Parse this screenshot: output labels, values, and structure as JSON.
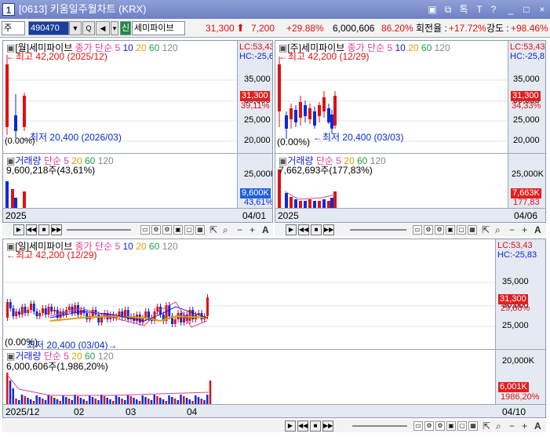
{
  "window": {
    "number": "1",
    "title": "[0613] 키움일주월차트 (KRX)",
    "controls": [
      "▣",
      "⧉",
      "톡",
      "T",
      "?",
      "_",
      "□",
      "×"
    ]
  },
  "toolbar": {
    "market": "주",
    "code": "490470",
    "badge": "신",
    "name": "세미파이브",
    "price": "31,300",
    "change": "7,200",
    "change_pct": "+29.88%",
    "volume": "6,000,606",
    "vol_ratio": "86.20%",
    "turnover_label": "회전율 :",
    "turnover": "+17.72%",
    "strength_label": "강도 :",
    "strength": "+98.46%"
  },
  "monthly": {
    "legend_name": "[월]세미파이브",
    "legend_ma": "종가 단순",
    "ma_periods": [
      "5",
      "10",
      "20",
      "60",
      "120"
    ],
    "high_text": "최고 42,200 (2025/12)",
    "low_text": "최저 20,400 (2026/03)",
    "pct_text": "(0.00%)",
    "lc": "LC:53,43",
    "hc": "HC:-25,6",
    "ticks": [
      "35,000",
      "30,000",
      "25,000",
      "20,000"
    ],
    "price_box": "31,300",
    "price_pct": "39,11%",
    "vol_title": "거래량",
    "vol_ma": "단순",
    "vol_ma_periods": [
      "5",
      "20",
      "60",
      "120"
    ],
    "vol_value": "9,600,218주(43,61%)",
    "vol_tick": "25,000K",
    "vol_box": "9,600K",
    "vol_pct": "43,61%",
    "date_left": "2025",
    "date_right": "04/01"
  },
  "weekly": {
    "legend_name": "[주]세미파이브",
    "legend_ma": "종가 단순",
    "ma_periods": [
      "5",
      "10",
      "20",
      "60",
      "120"
    ],
    "high_text": "최고 42,200 (12/29)",
    "low_text": "최저 20,400 (03/03)",
    "pct_text": "(0.00%)",
    "lc": "LC:53,43",
    "hc": "HC:-25,8",
    "ticks": [
      "35,000",
      "30,000",
      "25,000",
      "20,000"
    ],
    "price_box": "31,300",
    "price_pct": "34,33%",
    "vol_title": "거래량",
    "vol_ma": "단순",
    "vol_ma_periods": [
      "5",
      "20",
      "60",
      "120"
    ],
    "vol_value": "7,662,693주(177,83%)",
    "vol_tick": "25,000K",
    "vol_box": "7,663K",
    "vol_pct": "177,83",
    "date_left": "2025",
    "date_right": "04/06"
  },
  "daily": {
    "legend_name": "[일]세미파이브",
    "legend_ma": "종가 단순",
    "ma_periods": [
      "5",
      "10",
      "20",
      "60",
      "120"
    ],
    "high_text": "최고 42,200 (12/29)",
    "low_text": "최저 20,400 (03/04)",
    "pct_text": "(0.00%)",
    "lc": "LC:53,43",
    "hc": "HC:-25,83",
    "ticks": [
      "35,000",
      "30,000",
      "25,000"
    ],
    "price_box": "31,300",
    "price_pct": "29,88%",
    "vol_title": "거래량",
    "vol_ma": "단순",
    "vol_ma_periods": [
      "5",
      "20",
      "60",
      "120"
    ],
    "vol_value": "6,000,606주(1,986,20%)",
    "vol_tick": "20,000K",
    "vol_box": "6,001K",
    "vol_pct": "1986,20%",
    "dates": [
      "2025/12",
      "02",
      "03",
      "04"
    ],
    "date_right": "04/10"
  },
  "colors": {
    "up": "#e01010",
    "down": "#0a2bd8",
    "ma5": "#e0409a",
    "ma10": "#1a1acc",
    "ma20": "#e0a000",
    "ma60": "#20a050",
    "ma120": "#888888"
  }
}
